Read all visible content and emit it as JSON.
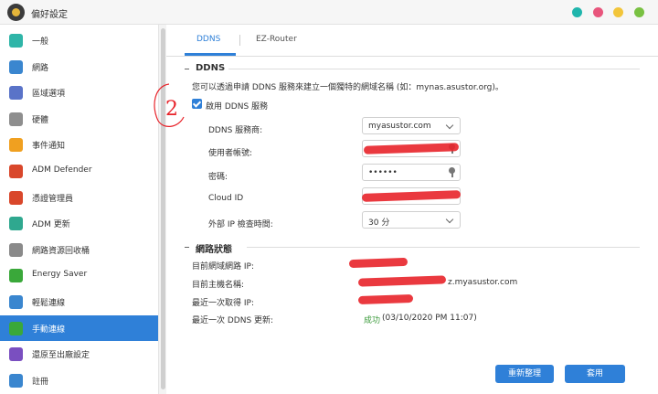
{
  "window": {
    "title": "偏好設定",
    "controls": [
      {
        "name": "teal",
        "color": "#1fb5ac"
      },
      {
        "name": "pink",
        "color": "#e8557c"
      },
      {
        "name": "yellow",
        "color": "#f2c53a"
      },
      {
        "name": "green",
        "color": "#79c142"
      },
      {
        "name": "purple",
        "color": "#b073c6"
      }
    ]
  },
  "sidebar": {
    "items": [
      {
        "label": "一般",
        "icon": "general-icon",
        "color": "#2fb5a8"
      },
      {
        "label": "網路",
        "icon": "globe-icon",
        "color": "#3a86cf"
      },
      {
        "label": "區域選項",
        "icon": "location-icon",
        "color": "#5a73c8"
      },
      {
        "label": "硬體",
        "icon": "hardware-icon",
        "color": "#8e8e8e"
      },
      {
        "label": "事件通知",
        "icon": "alert-icon",
        "color": "#f0a020"
      },
      {
        "label": "ADM Defender",
        "icon": "firewall-icon",
        "color": "#d9472b"
      },
      {
        "label": "憑證管理員",
        "icon": "certificate-icon",
        "color": "#d9472b"
      },
      {
        "label": "ADM 更新",
        "icon": "update-icon",
        "color": "#2fa88f"
      },
      {
        "label": "網路資源回收桶",
        "icon": "recycle-bin-icon",
        "color": "#8a8a8a"
      },
      {
        "label": "Energy Saver",
        "icon": "energy-icon",
        "color": "#3aa83a"
      },
      {
        "label": "輕鬆連線",
        "icon": "cloud-icon",
        "color": "#3a86cf"
      },
      {
        "label": "手動連線",
        "icon": "connect-icon",
        "color": "#3aa83a",
        "active": true
      },
      {
        "label": "還原至出廠設定",
        "icon": "reset-icon",
        "color": "#7a4fc0"
      },
      {
        "label": "註冊",
        "icon": "register-icon",
        "color": "#3a86cf"
      }
    ]
  },
  "tabs": [
    {
      "label": "DDNS",
      "active": true
    },
    {
      "label": "EZ-Router",
      "active": false
    }
  ],
  "ddns": {
    "section_title": "DDNS",
    "description": "您可以透過申請 DDNS 服務來建立一個獨特的網域名稱 (如：mynas.asustor.org)。",
    "enable_label": "啟用 DDNS 服務",
    "enable_checked": true,
    "provider_label": "DDNS 服務商:",
    "provider_value": "myasustor.com",
    "username_label": "使用者帳號:",
    "password_label": "密碼:",
    "password_value": "••••••",
    "cloud_id_label": "Cloud ID",
    "interval_label": "外部 IP 檢查時間:",
    "interval_value": "30 分"
  },
  "status": {
    "section_title": "網路狀態",
    "current_ip_label": "目前網域網路 IP:",
    "hostname_label": "目前主機名稱:",
    "hostname_value": "z.myasustor.com",
    "last_ip_label": "最近一次取得 IP:",
    "last_update_label": "最近一次 DDNS 更新:",
    "last_update_status": "成功",
    "last_update_time": "(03/10/2020 PM 11:07)",
    "success_color": "#3a9a3a"
  },
  "buttons": {
    "reset": "重新整理",
    "apply": "套用"
  },
  "annotation": {
    "handwritten_number": "2",
    "color": "#e8232a"
  }
}
